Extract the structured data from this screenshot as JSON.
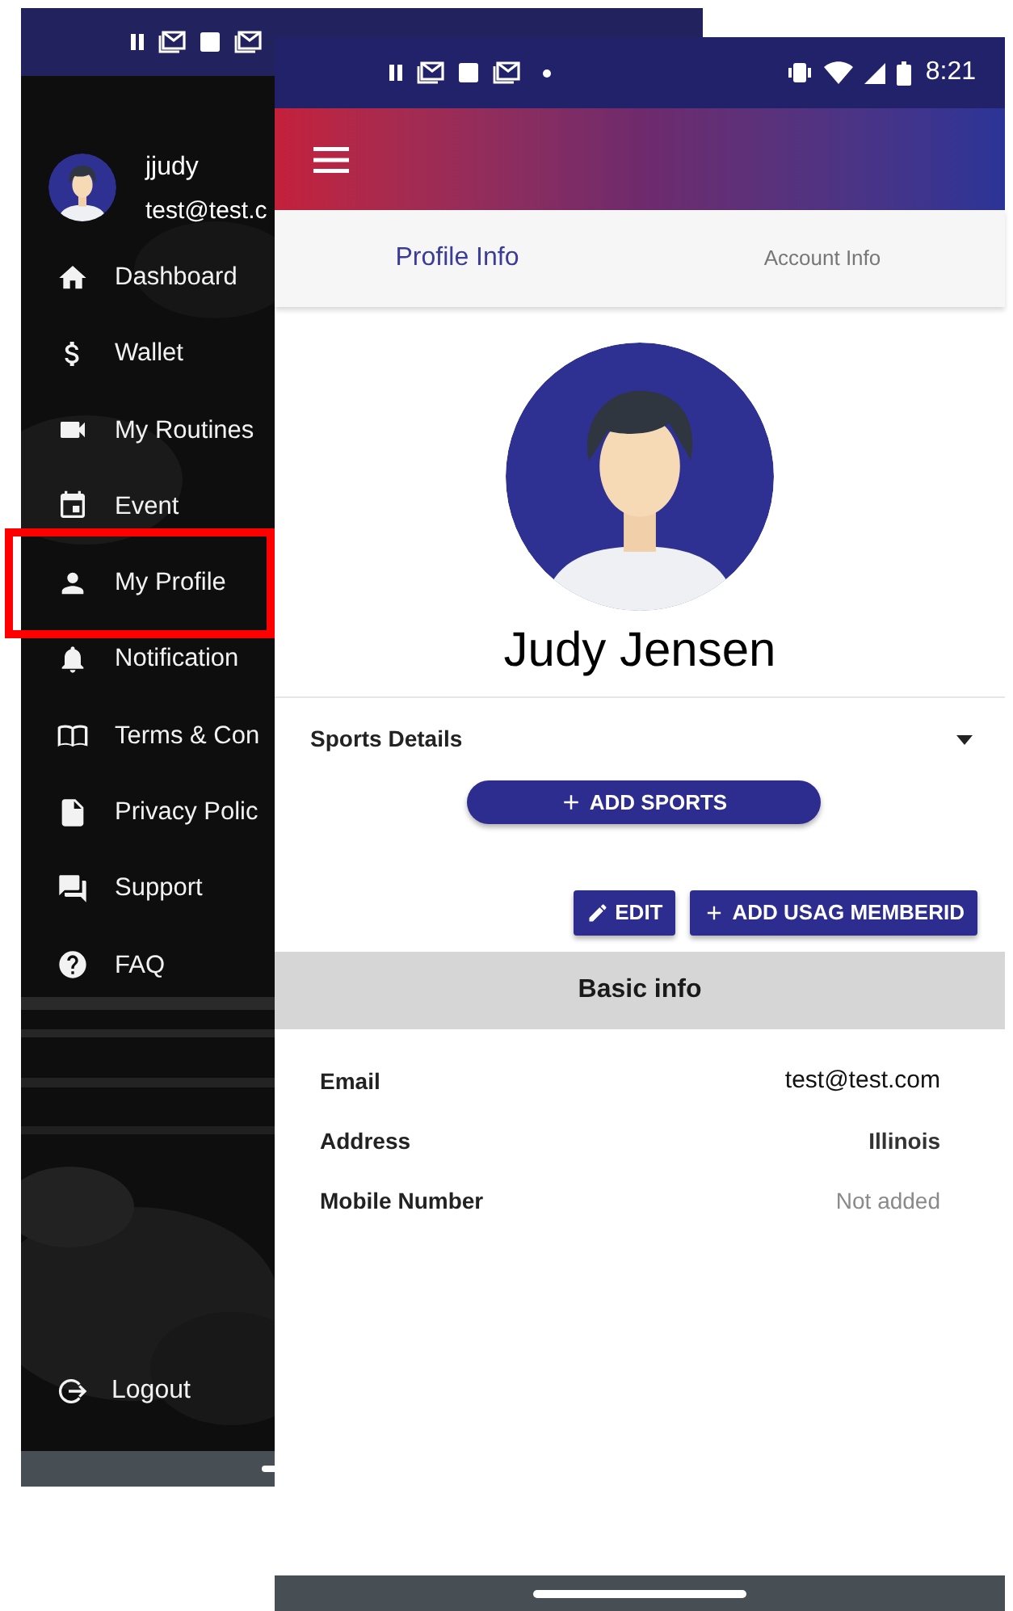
{
  "drawer": {
    "user": {
      "username": "jjudy",
      "email": "test@test.c"
    },
    "menu": [
      {
        "label": "Dashboard",
        "highlighted": false
      },
      {
        "label": "Wallet",
        "highlighted": false
      },
      {
        "label": "My Routines",
        "highlighted": false
      },
      {
        "label": "Event",
        "highlighted": false
      },
      {
        "label": "My Profile",
        "highlighted": true
      },
      {
        "label": "Notification",
        "highlighted": false
      },
      {
        "label": "Terms & Con",
        "highlighted": false
      },
      {
        "label": "Privacy Polic",
        "highlighted": false
      },
      {
        "label": "Support",
        "highlighted": false
      },
      {
        "label": "FAQ",
        "highlighted": false
      }
    ],
    "logout": "Logout"
  },
  "profile": {
    "status_bar": {
      "time": "8:21"
    },
    "tabs": [
      {
        "label": "Profile Info",
        "selected": true
      },
      {
        "label": "Account Info",
        "selected": false
      }
    ],
    "name": "Judy Jensen",
    "sports_section": {
      "title": "Sports Details",
      "button": "ADD SPORTS"
    },
    "actions": [
      {
        "label": "EDIT"
      },
      {
        "label": "ADD USAG MEMBERID"
      }
    ],
    "basic_info": {
      "title": "Basic info",
      "rows": [
        {
          "label": "Email",
          "value": "test@test.com",
          "kind": "email"
        },
        {
          "label": "Address",
          "value": "Illinois",
          "kind": "bold"
        },
        {
          "label": "Mobile Number",
          "value": "Not added",
          "kind": "missing"
        }
      ]
    }
  }
}
